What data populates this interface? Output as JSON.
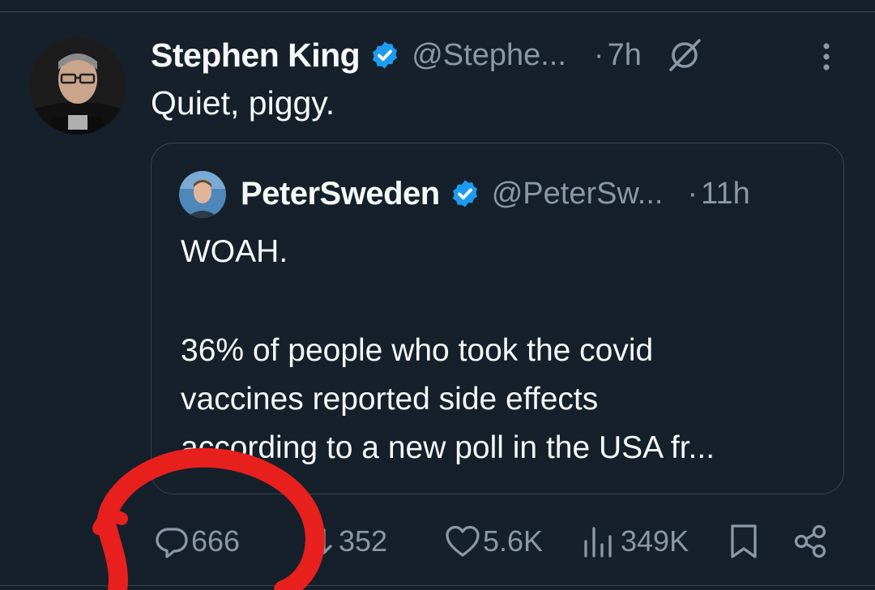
{
  "tweet": {
    "display_name": "Stephen King",
    "handle": "@Stephe...",
    "time": "7h",
    "text": "Quiet, piggy."
  },
  "quoted": {
    "display_name": "PeterSweden",
    "handle": "@PeterSw...",
    "time": "11h",
    "lines": [
      "WOAH.",
      "36% of people who took the covid",
      "vaccines reported side effects",
      "according to a new poll in the USA fr..."
    ]
  },
  "actions": {
    "replies": "666",
    "reposts": "352",
    "likes": "5.6K",
    "views": "349K"
  },
  "icons": {
    "verified": "verified-badge-icon",
    "grok": "grok-icon",
    "more": "more-options-icon",
    "reply": "reply-icon",
    "repost": "repost-icon",
    "like": "heart-icon",
    "views": "views-icon",
    "bookmark": "bookmark-icon",
    "share": "share-icon"
  },
  "colors": {
    "background": "#15202b",
    "verified": "#1d9bf0",
    "secondary_text": "#8b98a5",
    "annotation": "#e8201e"
  }
}
